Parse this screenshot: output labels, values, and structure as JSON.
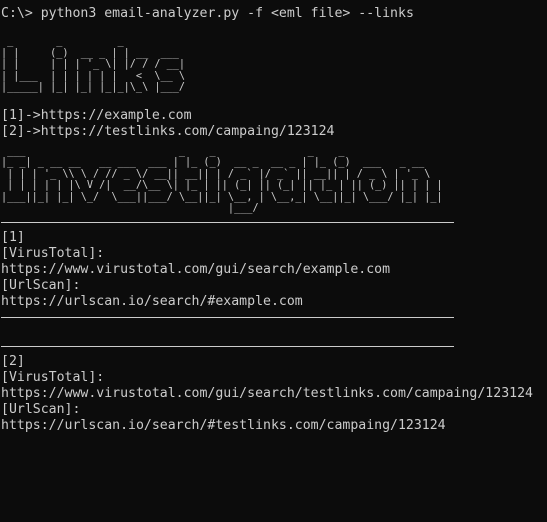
{
  "window": {
    "prompt": "C:\\>",
    "command": "python3 email-analyzer.py -f <eml file> --links"
  },
  "banners": {
    "links": " _       _         _\n| |     (_)  __ _ | | __  ___\n| |     | | | '_ \\| |/ / / __|\n| |___  | | | | | |   <  \\__ \\\n|_____| |_| |_| |_|_|\\_\\ |___/",
    "investigation": " ___                         _    _               _    _\n|_ _| _ __ __   __ ___  ___ | |_ (_)  __ _  __ _ | |_ (_)  ___   _ __\n | | | '_ \\\\ \\ / // _ \\/ __|| __|| | / _` |/ _` || __|| | / _ \\ | '_ \\\n | | | | | |\\ V /|  __/\\__ \\| |_ | || (_| || (_| || |_ | || (_) || | | |\n|___||_| |_| \\_/  \\___||___/ \\__||_| \\__, | \\__,_| \\__||_| \\___/ |_| |_|\n                                     |___/"
  },
  "links": [
    {
      "label": "[1]->https://example.com"
    },
    {
      "label": "[2]->https://testlinks.com/campaing/123124"
    }
  ],
  "results": [
    {
      "index": "[1]",
      "virustotal_label": "[VirusTotal]:",
      "virustotal_url": "https://www.virustotal.com/gui/search/example.com",
      "urlscan_label": "[UrlScan]:",
      "urlscan_url": "https://urlscan.io/search/#example.com"
    },
    {
      "index": "[2]",
      "virustotal_label": "[VirusTotal]:",
      "virustotal_url": "https://www.virustotal.com/gui/search/testlinks.com/campaing/123124",
      "urlscan_label": "[UrlScan]:",
      "urlscan_url": "https://urlscan.io/search/#testlinks.com/campaing/123124"
    }
  ],
  "colors": {
    "background": "#0c0c0c",
    "text": "#cccccc"
  }
}
